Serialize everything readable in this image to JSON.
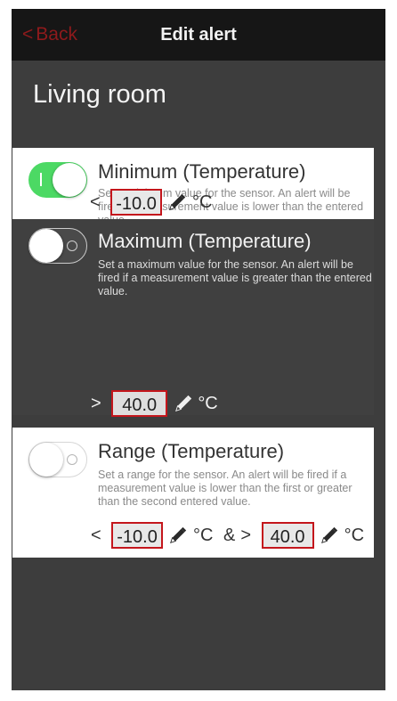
{
  "nav": {
    "back_label": "Back",
    "back_chevron": "<",
    "title": "Edit alert"
  },
  "room": {
    "name": "Living room"
  },
  "alerts": [
    {
      "title": "Minimum (Temperature)",
      "description": "Set a minimum value for the sensor. An alert will be fired if a measurement value is lower than the entered value.",
      "enabled": true,
      "operator": "<",
      "value": "-10.0",
      "unit": "°C"
    },
    {
      "title": "Maximum (Temperature)",
      "description": "Set a maximum value for the sensor. An alert will be fired if a measurement value is greater than the entered value.",
      "enabled": false,
      "operator": ">",
      "value": "40.0",
      "unit": "°C"
    },
    {
      "title": "Range (Temperature)",
      "description": "Set a range for the sensor. An alert will be fired if a measurement value is lower than the first or greater than the second entered value.",
      "enabled": false,
      "operator_low": "<",
      "value_low": "-10.0",
      "unit_low": "°C",
      "joiner": "&",
      "operator_high": ">",
      "value_high": "40.0",
      "unit_high": "°C"
    }
  ],
  "colors": {
    "accent_back": "#8e1a1c",
    "toggle_on": "#4cd964",
    "value_highlight_border": "#c4161c",
    "background": "#3d3d3d"
  },
  "icons": {
    "pencil": "pencil-icon",
    "toggle": "toggle-switch"
  }
}
